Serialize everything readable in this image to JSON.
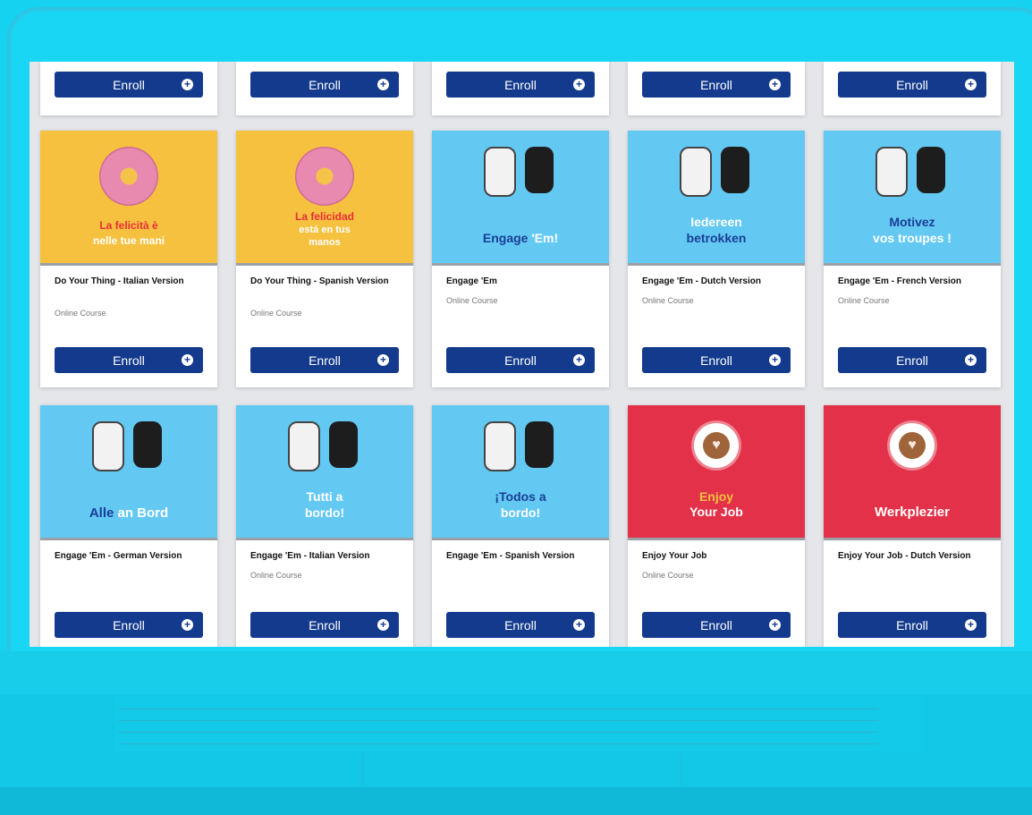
{
  "enroll_label": "Enroll",
  "colors": {
    "yellow": "#f5c13f",
    "blue": "#63c9f3",
    "red": "#e23148",
    "button": "#133a8c"
  },
  "top_row_buttons": [
    "Enroll",
    "Enroll",
    "Enroll",
    "Enroll",
    "Enroll"
  ],
  "cards": [
    {
      "title": "Do Your Thing - Italian Version",
      "subtitle": "Online Course",
      "thumb_text_1": "La felicità è",
      "thumb_text_2": "nelle tue mani",
      "thumb_text_3": ""
    },
    {
      "title": "Do Your Thing - Spanish Version",
      "subtitle": "Online Course",
      "thumb_text_1": "La felicidad",
      "thumb_text_2": "está en tus",
      "thumb_text_3": "manos"
    },
    {
      "title": "Engage 'Em",
      "subtitle": "Online Course",
      "thumb_text_1": "Engage",
      "thumb_text_2": "'Em!",
      "thumb_text_3": ""
    },
    {
      "title": "Engage 'Em - Dutch Version",
      "subtitle": "Online Course",
      "thumb_text_1": "Iedereen",
      "thumb_text_2": "betrokken",
      "thumb_text_3": ""
    },
    {
      "title": "Engage 'Em - French Version",
      "subtitle": "Online Course",
      "thumb_text_1": "Motivez",
      "thumb_text_2": "vos troupes !",
      "thumb_text_3": ""
    },
    {
      "title": "Engage 'Em - German Version",
      "subtitle": "",
      "thumb_text_1": "Alle",
      "thumb_text_2": "an Bord",
      "thumb_text_3": ""
    },
    {
      "title": "Engage 'Em - Italian Version",
      "subtitle": "Online Course",
      "thumb_text_1": "Tutti a",
      "thumb_text_2": "bordo!",
      "thumb_text_3": ""
    },
    {
      "title": "Engage 'Em - Spanish Version",
      "subtitle": "",
      "thumb_text_1": "¡Todos a",
      "thumb_text_2": "bordo!",
      "thumb_text_3": ""
    },
    {
      "title": "Enjoy Your Job",
      "subtitle": "Online Course",
      "thumb_text_1": "Enjoy",
      "thumb_text_2": "Your Job",
      "thumb_text_3": ""
    },
    {
      "title": "Enjoy Your Job - Dutch Version",
      "subtitle": "",
      "thumb_text_1": "Werkplezier",
      "thumb_text_2": "",
      "thumb_text_3": ""
    }
  ]
}
